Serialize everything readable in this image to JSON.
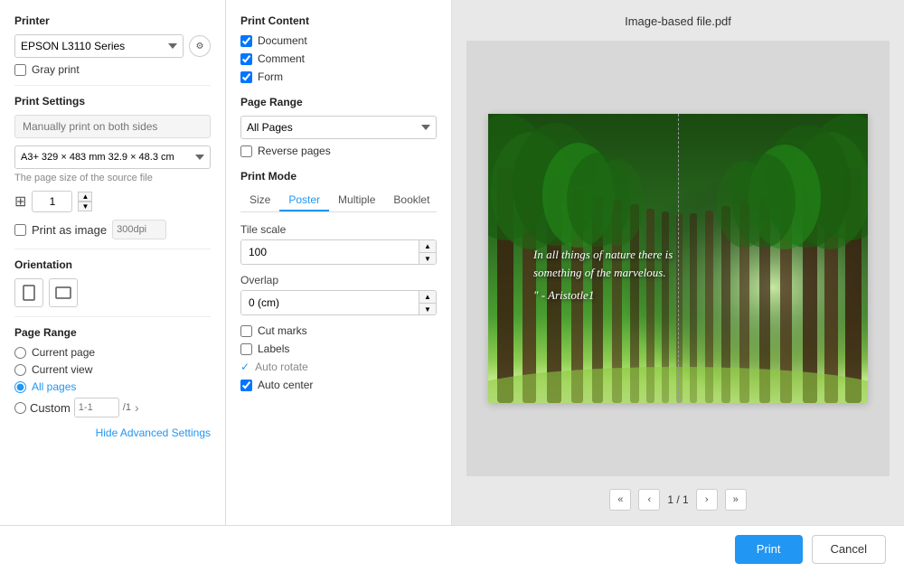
{
  "header": {
    "file_name": "Image-based file.pdf"
  },
  "left_panel": {
    "printer_section_title": "Printer",
    "printer_name": "EPSON L3110 Series",
    "gray_print_label": "Gray print",
    "print_settings_title": "Print Settings",
    "both_sides_placeholder": "Manually print on both sides",
    "page_size_value": "A3+ 329 × 483 mm 32.9 × 48.3 cm",
    "page_size_hint": "The page size of the source file",
    "copies_label": "1",
    "print_as_image_label": "Print as image",
    "dpi_placeholder": "300dpi",
    "orientation_title": "Orientation",
    "page_range_title": "Page Range",
    "current_page_label": "Current page",
    "current_view_label": "Current view",
    "all_pages_label": "All pages",
    "custom_label": "Custom",
    "custom_placeholder": "1-1",
    "total_pages": "/1",
    "hide_advanced": "Hide Advanced Settings"
  },
  "middle_panel": {
    "print_content_title": "Print Content",
    "document_label": "Document",
    "comment_label": "Comment",
    "form_label": "Form",
    "page_range_title": "Page Range",
    "all_pages_option": "All Pages",
    "reverse_pages_label": "Reverse pages",
    "print_mode_title": "Print Mode",
    "tabs": [
      {
        "label": "Size",
        "active": false
      },
      {
        "label": "Poster",
        "active": true
      },
      {
        "label": "Multiple",
        "active": false
      },
      {
        "label": "Booklet",
        "active": false
      }
    ],
    "tile_scale_label": "Tile scale",
    "tile_scale_value": "100",
    "overlap_label": "Overlap",
    "overlap_value": "0 (cm)",
    "cut_marks_label": "Cut marks",
    "labels_label": "Labels",
    "auto_rotate_label": "Auto rotate",
    "auto_center_label": "Auto center"
  },
  "preview": {
    "quote": "In all things of nature there is something of the marvelous.\n\" - Aristotle1"
  },
  "pagination": {
    "current": "1",
    "total": "1",
    "separator": "/"
  },
  "footer": {
    "print_btn": "Print",
    "cancel_btn": "Cancel"
  }
}
